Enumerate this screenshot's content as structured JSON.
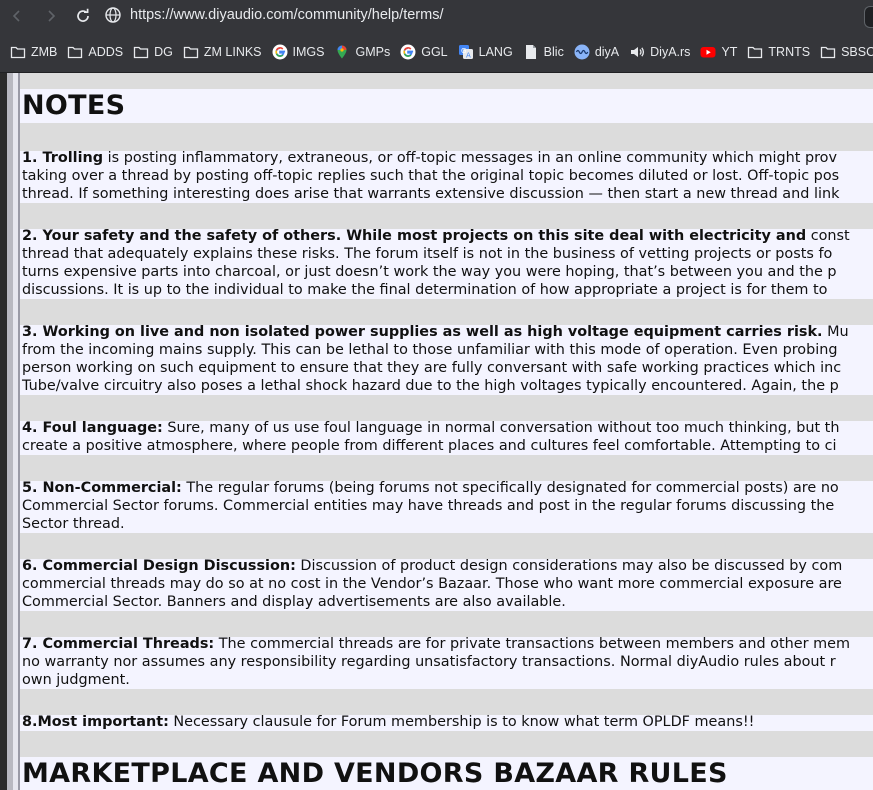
{
  "browser": {
    "url": "https://www.diyaudio.com/community/help/terms/",
    "bookmarks": [
      {
        "label": "ZMB",
        "icon": "folder-icon"
      },
      {
        "label": "ADDS",
        "icon": "folder-icon"
      },
      {
        "label": "DG",
        "icon": "folder-icon"
      },
      {
        "label": "ZM LINKS",
        "icon": "folder-icon"
      },
      {
        "label": "IMGS",
        "icon": "google-icon"
      },
      {
        "label": "GMPs",
        "icon": "maps-pin-icon"
      },
      {
        "label": "GGL",
        "icon": "google-icon"
      },
      {
        "label": "LANG",
        "icon": "translate-icon"
      },
      {
        "label": "Blic",
        "icon": "document-icon"
      },
      {
        "label": "diyA",
        "icon": "wave-icon"
      },
      {
        "label": "DiyA.rs",
        "icon": "speaker-icon"
      },
      {
        "label": "YT",
        "icon": "youtube-icon"
      },
      {
        "label": "TRNTS",
        "icon": "folder-icon"
      },
      {
        "label": "SBSCRB",
        "icon": "folder-icon"
      }
    ]
  },
  "page": {
    "heading_notes": "NOTES",
    "heading_marketplace": "MARKETPLACE AND VENDORS BAZAAR RULES",
    "notes": [
      {
        "title": "1. Trolling",
        "lines": [
          " is posting inflammatory, extraneous, or off-topic messages in an online community which might prov",
          "taking over a thread by posting off-topic replies such that the original topic becomes diluted or lost. Off-topic pos",
          "thread. If something interesting does arise that warrants extensive discussion — then start a new thread and link"
        ]
      },
      {
        "title": "2. Your safety and the safety of others. While most projects on this site deal with electricity and",
        "lines": [
          " const",
          "thread that adequately explains these risks. The forum itself is not in the business of vetting projects or posts fo",
          "turns expensive parts into charcoal, or just doesn’t work the way you were hoping, that’s between you and the p",
          "discussions. It is up to the individual to make the final determination of how appropriate a project is for them to"
        ]
      },
      {
        "title": "3. Working on live and non isolated power supplies as well as high voltage equipment carries risk.",
        "lines": [
          " Mu",
          "from the incoming mains supply. This can be lethal to those unfamiliar with this mode of operation. Even probing",
          "person working on such equipment to ensure that they are fully conversant with safe working practices which inc",
          "Tube/valve circuitry also poses a lethal shock hazard due to the high voltages typically encountered. Again, the p"
        ]
      },
      {
        "title": "4. Foul language:",
        "lines": [
          " Sure, many of us use foul language in normal conversation without too much thinking, but th",
          "create a positive atmosphere, where people from different places and cultures feel comfortable. Attempting to ci"
        ]
      },
      {
        "title": "5. Non-Commercial:",
        "lines": [
          " The regular forums (being forums not specifically designated for commercial posts) are no",
          "Commercial Sector forums. Commercial entities may have threads and post in the regular forums discussing the",
          "Sector thread."
        ]
      },
      {
        "title": "6. Commercial Design Discussion:",
        "lines": [
          " Discussion of product design considerations may also be discussed by com",
          "commercial threads may do so at no cost in the Vendor’s Bazaar. Those who want more commercial exposure are",
          "Commercial Sector. Banners and display advertisements are also available."
        ]
      },
      {
        "title": "7. Commercial Threads:",
        "lines": [
          " The commercial threads are for private transactions between members and other mem",
          "no warranty nor assumes any responsibility regarding unsatisfactory transactions. Normal diyAudio rules about r",
          "own judgment."
        ]
      },
      {
        "title": "8.Most important:",
        "lines": [
          " Necessary clausule for Forum membership is to know what term OPLDF means!!"
        ]
      }
    ]
  }
}
